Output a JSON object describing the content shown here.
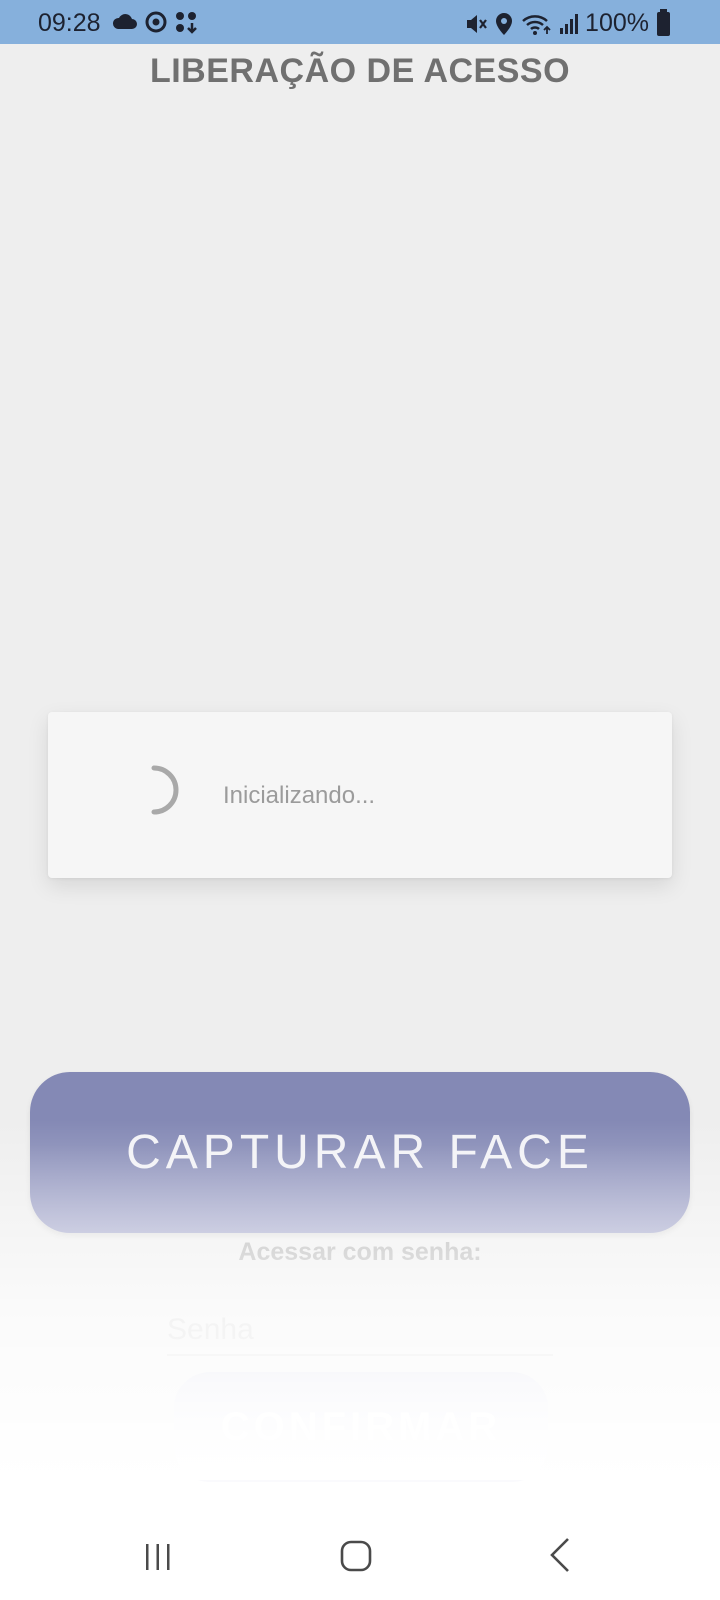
{
  "status_bar": {
    "time": "09:28",
    "battery": "100%",
    "left_icons": [
      "cloud-icon",
      "sync-icon",
      "apps-icon"
    ],
    "right_icons": [
      "mute-icon",
      "location-icon",
      "wifi-icon",
      "signal-icon",
      "battery-icon"
    ]
  },
  "header": {
    "title": "LIBERAÇÃO DE ACESSO"
  },
  "loading_dialog": {
    "message": "Inicializando...",
    "icon": "spinner-icon"
  },
  "main": {
    "capture_button_label": "CAPTURAR FACE",
    "password_label": "Acessar com senha:",
    "password_placeholder": "Senha",
    "password_value": "",
    "confirm_button_label": "CONFIRMAR"
  },
  "nav_bar": {
    "icons": [
      "recents-icon",
      "home-icon",
      "back-icon"
    ]
  },
  "colors": {
    "status_bar": "#86b0dc",
    "primary_button": "#8489b5",
    "background": "#eeeeee"
  }
}
